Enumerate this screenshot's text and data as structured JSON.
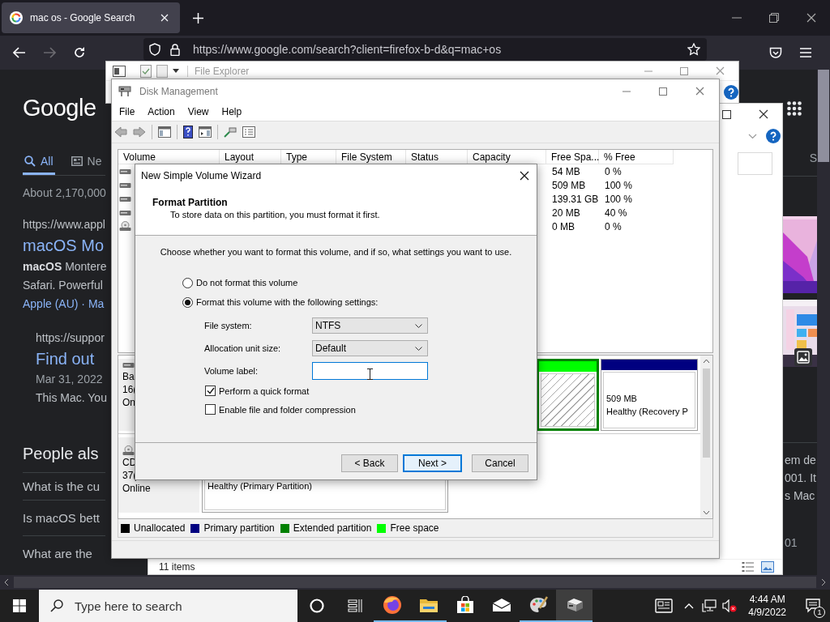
{
  "browser": {
    "tab_title": "mac os - Google Search",
    "url": "https://www.google.com/search?client=firefox-b-d&q=mac+os"
  },
  "google": {
    "logo": "Google",
    "tabs": [
      {
        "kind": "all",
        "label": "All",
        "selected": true
      },
      {
        "kind": "news",
        "label": "Ne",
        "selected": false
      }
    ],
    "stats": "About 2,170,000",
    "result": {
      "url": "https://www.appl",
      "title": "macOS Mo",
      "snippet": [
        "**macOS** Montere",
        "Safari. Powerful"
      ],
      "links": "Apple (AU) · Ma"
    },
    "sub_result": {
      "url": "https://suppor",
      "title": "Find out",
      "date": "Mar 31, 2022",
      "snippet": "This Mac. You"
    },
    "people_also_ask": {
      "heading": "People als",
      "questions": [
        "What is the cu",
        "Is macOS bett",
        "What are the"
      ]
    },
    "side": {
      "tab": "S",
      "snippet": [
        "em de",
        "001. It",
        "s Mac"
      ],
      "date": "01"
    }
  },
  "explorer": {
    "title": "File Explorer",
    "status": "11 items"
  },
  "disk_management": {
    "title": "Disk Management",
    "menu": [
      "File",
      "Action",
      "View",
      "Help"
    ],
    "columns": [
      "Volume",
      "Layout",
      "Type",
      "File System",
      "Status",
      "Capacity",
      "Free Spa...",
      "% Free"
    ],
    "rows": [
      {
        "kind": "disk",
        "free": "54 MB",
        "percent": "0 %"
      },
      {
        "kind": "disk",
        "free": "509 MB",
        "percent": "100 %"
      },
      {
        "kind": "disk",
        "free": "139.31 GB",
        "percent": "100 %"
      },
      {
        "kind": "disk",
        "free": "20 MB",
        "percent": "40 %"
      },
      {
        "kind": "cd",
        "free": "0 MB",
        "percent": "0 %"
      }
    ],
    "disks": [
      {
        "kind": "disk",
        "lines": [
          "Ba",
          "16(",
          "On"
        ],
        "partitions": [
          {
            "kind": "free",
            "color": "#00ff00",
            "selected": true
          },
          {
            "kind": "primary",
            "color": "#000080",
            "selected": false,
            "size": "509 MB",
            "status": "Healthy (Recovery P"
          }
        ]
      },
      {
        "kind": "cd",
        "lines": [
          "CD",
          "37(",
          "Online"
        ],
        "partitions": [
          {
            "kind": "primary",
            "selected": false,
            "status": "Healthy (Primary Partition)"
          }
        ]
      }
    ],
    "legend": [
      {
        "label": "Unallocated",
        "color": "#000000"
      },
      {
        "label": "Primary partition",
        "color": "#000080"
      },
      {
        "label": "Extended partition",
        "color": "#008000"
      },
      {
        "label": "Free space",
        "color": "#00ff00"
      }
    ]
  },
  "wizard": {
    "title": "New Simple Volume Wizard",
    "heading": "Format Partition",
    "subheading": "To store data on this partition, you must format it first.",
    "instruction": "Choose whether you want to format this volume, and if so, what settings you want to use.",
    "options": [
      {
        "label": "Do not format this volume",
        "selected": false
      },
      {
        "label": "Format this volume with the following settings:",
        "selected": true
      }
    ],
    "fields": [
      {
        "kind": "dropdown",
        "label": "File system:",
        "value": "NTFS"
      },
      {
        "kind": "dropdown",
        "label": "Allocation unit size:",
        "value": "Default"
      },
      {
        "kind": "text",
        "label": "Volume label:",
        "focused": true
      }
    ],
    "checkboxes": [
      {
        "label": "Perform a quick format",
        "checked": true
      },
      {
        "label": "Enable file and folder compression",
        "checked": false
      }
    ],
    "buttons": [
      {
        "label": "< Back",
        "default": false
      },
      {
        "label": "Next >",
        "default": true
      },
      {
        "label": "Cancel",
        "default": false
      }
    ]
  },
  "taskbar": {
    "search_placeholder": "Type here to search",
    "apps": [
      {
        "kind": "firefox",
        "running": true,
        "active": false
      },
      {
        "kind": "folder",
        "running": true,
        "active": false
      },
      {
        "kind": "store",
        "running": false,
        "active": false
      },
      {
        "kind": "mail",
        "running": false,
        "active": false
      },
      {
        "kind": "paint",
        "running": true,
        "active": false
      },
      {
        "kind": "diskmgmt",
        "running": true,
        "active": true
      }
    ],
    "time": "4:44 AM",
    "date": "4/9/2022",
    "notifications": "1"
  }
}
